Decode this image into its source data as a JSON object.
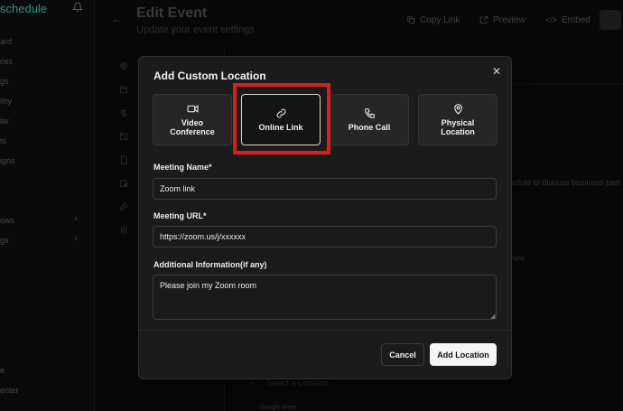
{
  "app": {
    "brand": "schedule"
  },
  "sidebar": {
    "items": [
      "ard",
      "ces",
      "gs",
      "ility",
      "lar",
      "ts",
      "igns",
      "ows",
      "gs",
      "e",
      "enter"
    ]
  },
  "header": {
    "title": "Edit Event",
    "subtitle": "Update your event settings",
    "copy_link": "Copy Link",
    "preview": "Preview",
    "embed": "Embed"
  },
  "background": {
    "description_hint": "edule to discuss business part",
    "attendee_hint": "nee",
    "select_location": "Select a Location",
    "google_meet": "Google Meet"
  },
  "modal": {
    "title": "Add Custom Location",
    "options": [
      {
        "label": "Video\nConference",
        "icon": "video-camera-icon",
        "selected": false
      },
      {
        "label": "Online Link",
        "icon": "link-icon",
        "selected": true
      },
      {
        "label": "Phone Call",
        "icon": "phone-icon",
        "selected": false
      },
      {
        "label": "Physical\nLocation",
        "icon": "map-pin-icon",
        "selected": false
      }
    ],
    "meeting_name_label": "Meeting Name*",
    "meeting_name_value": "Zoom link",
    "meeting_url_label": "Meeting URL*",
    "meeting_url_value": "https://zoom.us/j/xxxxxx",
    "additional_info_label": "Additional Information(if any)",
    "additional_info_value": "Please join my Zoom room",
    "cancel_label": "Cancel",
    "add_label": "Add Location"
  },
  "colors": {
    "highlight": "#d61f1f",
    "brand": "#3ec7b5"
  }
}
